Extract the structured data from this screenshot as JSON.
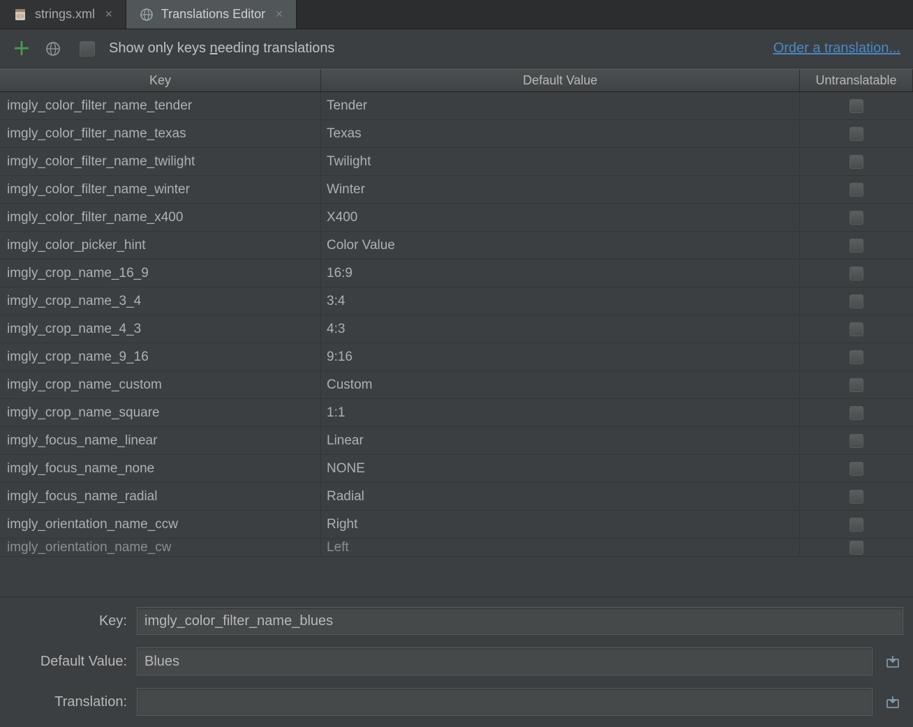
{
  "tabs": [
    {
      "label": "strings.xml",
      "active": false
    },
    {
      "label": "Translations Editor",
      "active": true
    }
  ],
  "toolbar": {
    "show_only_label_pre": "Show only keys ",
    "show_only_label_ul": "n",
    "show_only_label_post": "eeding translations",
    "order_link": "Order a translation..."
  },
  "columns": {
    "key": "Key",
    "default_value": "Default Value",
    "untranslatable": "Untranslatable"
  },
  "rows": [
    {
      "key": "imgly_color_filter_name_tender",
      "value": "Tender",
      "untranslatable": false
    },
    {
      "key": "imgly_color_filter_name_texas",
      "value": "Texas",
      "untranslatable": false
    },
    {
      "key": "imgly_color_filter_name_twilight",
      "value": "Twilight",
      "untranslatable": false
    },
    {
      "key": "imgly_color_filter_name_winter",
      "value": "Winter",
      "untranslatable": false
    },
    {
      "key": "imgly_color_filter_name_x400",
      "value": "X400",
      "untranslatable": false
    },
    {
      "key": "imgly_color_picker_hint",
      "value": "Color Value",
      "untranslatable": false
    },
    {
      "key": "imgly_crop_name_16_9",
      "value": "16:9",
      "untranslatable": false
    },
    {
      "key": "imgly_crop_name_3_4",
      "value": "3:4",
      "untranslatable": false
    },
    {
      "key": "imgly_crop_name_4_3",
      "value": "4:3",
      "untranslatable": false
    },
    {
      "key": "imgly_crop_name_9_16",
      "value": "9:16",
      "untranslatable": false
    },
    {
      "key": "imgly_crop_name_custom",
      "value": "Custom",
      "untranslatable": false
    },
    {
      "key": "imgly_crop_name_square",
      "value": "1:1",
      "untranslatable": false
    },
    {
      "key": "imgly_focus_name_linear",
      "value": "Linear",
      "untranslatable": false
    },
    {
      "key": "imgly_focus_name_none",
      "value": "NONE",
      "untranslatable": false
    },
    {
      "key": "imgly_focus_name_radial",
      "value": "Radial",
      "untranslatable": false
    },
    {
      "key": "imgly_orientation_name_ccw",
      "value": "Right",
      "untranslatable": false
    },
    {
      "key": "imgly_orientation_name_cw",
      "value": "Left",
      "untranslatable": false
    }
  ],
  "detail": {
    "key_label": "Key:",
    "key_value": "imgly_color_filter_name_blues",
    "default_label": "Default Value:",
    "default_value": "Blues",
    "translation_label": "Translation:",
    "translation_value": ""
  }
}
